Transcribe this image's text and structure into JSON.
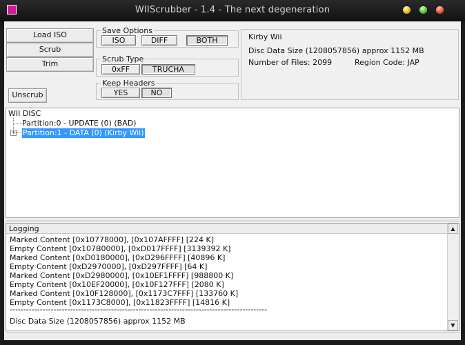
{
  "window": {
    "title": "WIIScrubber - 1.4 - The next degeneration",
    "app_icon": "wiiscrubber-app-icon",
    "controls": [
      "minimize-button",
      "maximize-button",
      "close-button"
    ]
  },
  "actions": {
    "load_iso": "Load ISO",
    "scrub": "Scrub",
    "trim": "Trim",
    "unscrub": "Unscrub"
  },
  "save_options": {
    "label": "Save Options",
    "iso": "ISO",
    "diff": "DIFF",
    "both": "BOTH",
    "selected": "BOTH"
  },
  "scrub_type": {
    "label": "Scrub Type",
    "oxff": "0xFF",
    "trucha": "TRUCHA",
    "selected": "TRUCHA"
  },
  "keep_headers": {
    "label": "Keep Headers",
    "yes": "YES",
    "no": "NO",
    "selected": "NO"
  },
  "disc_info": {
    "title": "Kirby Wii",
    "data_size": "Disc Data Size (1208057856) approx  1152 MB",
    "num_files": "Number of Files: 2099",
    "region": "Region Code: JAP"
  },
  "tree": {
    "root": "WII DISC",
    "partitions": [
      "Partition:0 - UPDATE (0) (BAD)",
      "Partition:1 - DATA (0) (Kirby Wii)"
    ],
    "selected_index": 1
  },
  "logging": {
    "header": "Logging",
    "lines": [
      "Marked Content [0x10778000], [0x107AFFFF] [224 K]",
      "Empty Content [0x107B0000], [0xD017FFFF] [3139392 K]",
      "Marked Content [0xD0180000], [0xD296FFFF] [40896 K]",
      "Empty Content [0xD2970000], [0xD297FFFF] [64 K]",
      "Marked Content [0xD2980000], [0x10EF1FFFF] [988800 K]",
      "Empty Content [0x10EF20000], [0x10F127FFF] [2080 K]",
      "Marked Content [0x10F128000], [0x1173C7FFF] [133760 K]",
      "Empty Content [0x1173C8000], [0x11823FFFF] [14816 K]"
    ],
    "separator": "----------------------------------------------------------------------------------------------",
    "summary": "Disc Data Size (1208057856) approx  1152 MB"
  }
}
